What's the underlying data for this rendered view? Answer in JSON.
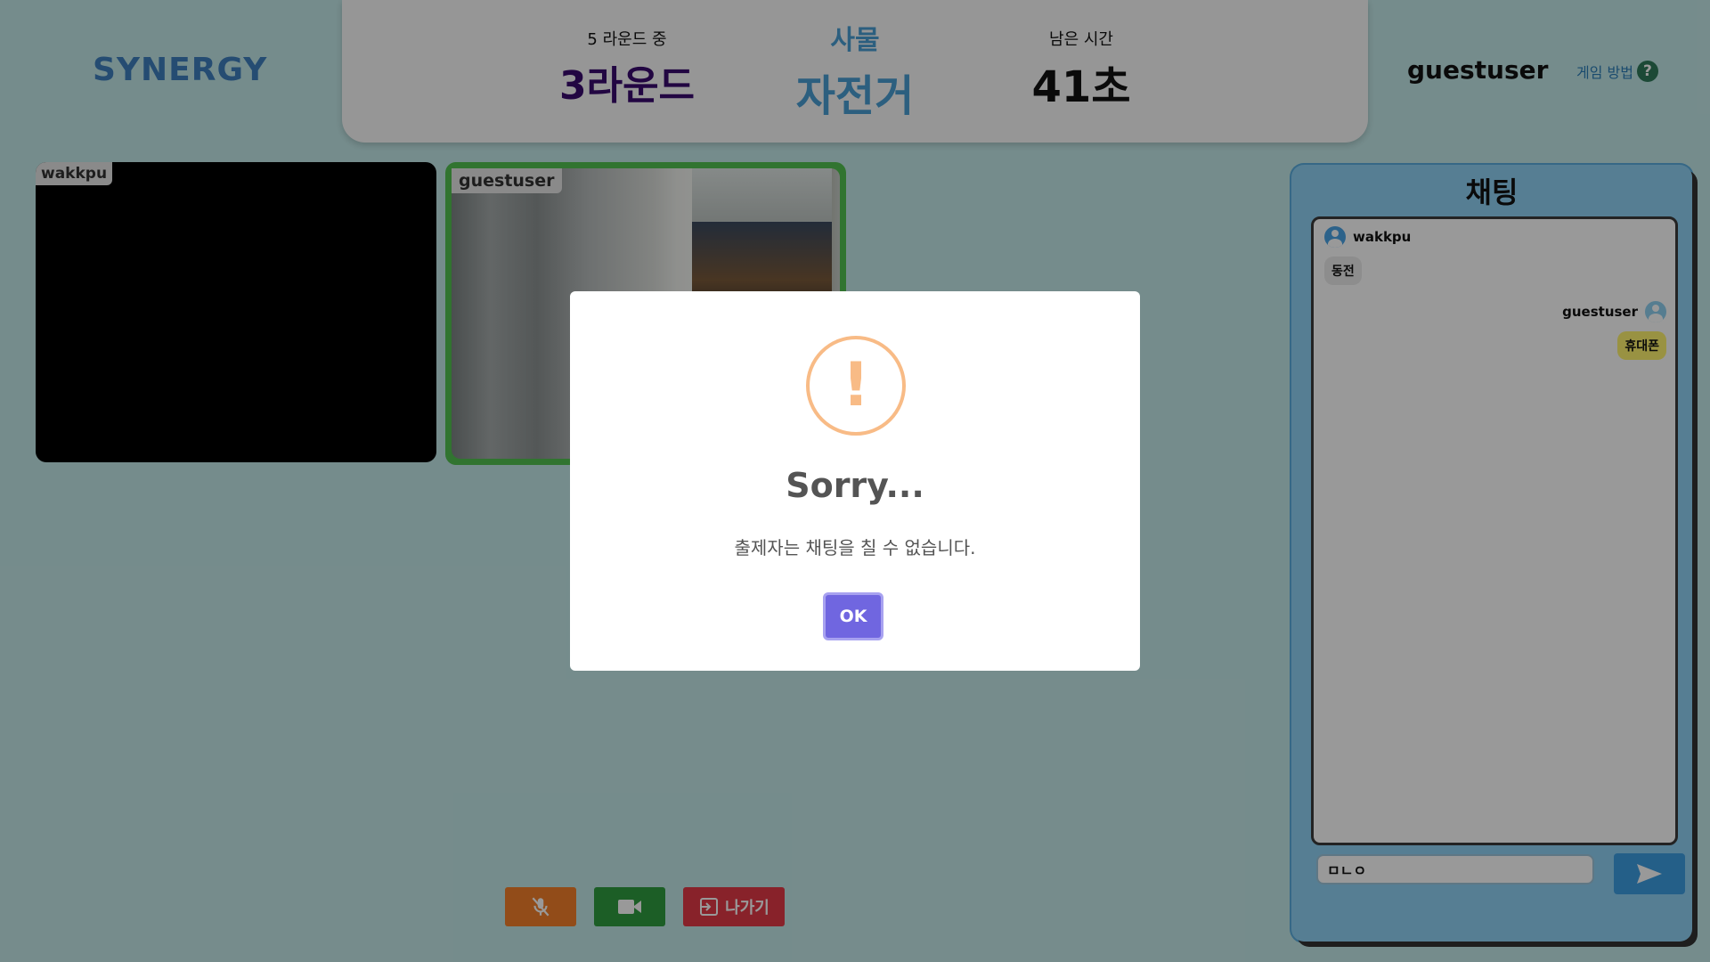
{
  "header": {
    "logo": "SYNERGY",
    "round_of": "5 라운드 중",
    "round": "3라운드",
    "category": "사물",
    "word": "자전거",
    "time_label": "남은 시간",
    "time_value": "41초",
    "username": "guestuser",
    "how_to_play": "게임 방법",
    "help_glyph": "?"
  },
  "videos": [
    {
      "label": "wakkpu"
    },
    {
      "label": "guestuser"
    }
  ],
  "controls": {
    "exit_label": "나가기",
    "colors": {
      "mic": "#f37f2a",
      "cam": "#2f9d40",
      "exit": "#e33a47"
    }
  },
  "chat": {
    "title": "채팅",
    "messages": [
      {
        "user": "wakkpu",
        "text": "동전"
      },
      {
        "user": "guestuser",
        "text": "휴대폰"
      }
    ],
    "input_value": "ㅁㄴㅇ"
  },
  "modal": {
    "icon": "!",
    "title": "Sorry...",
    "text": "출제자는 채팅을 칠 수 없습니다.",
    "ok": "OK"
  }
}
